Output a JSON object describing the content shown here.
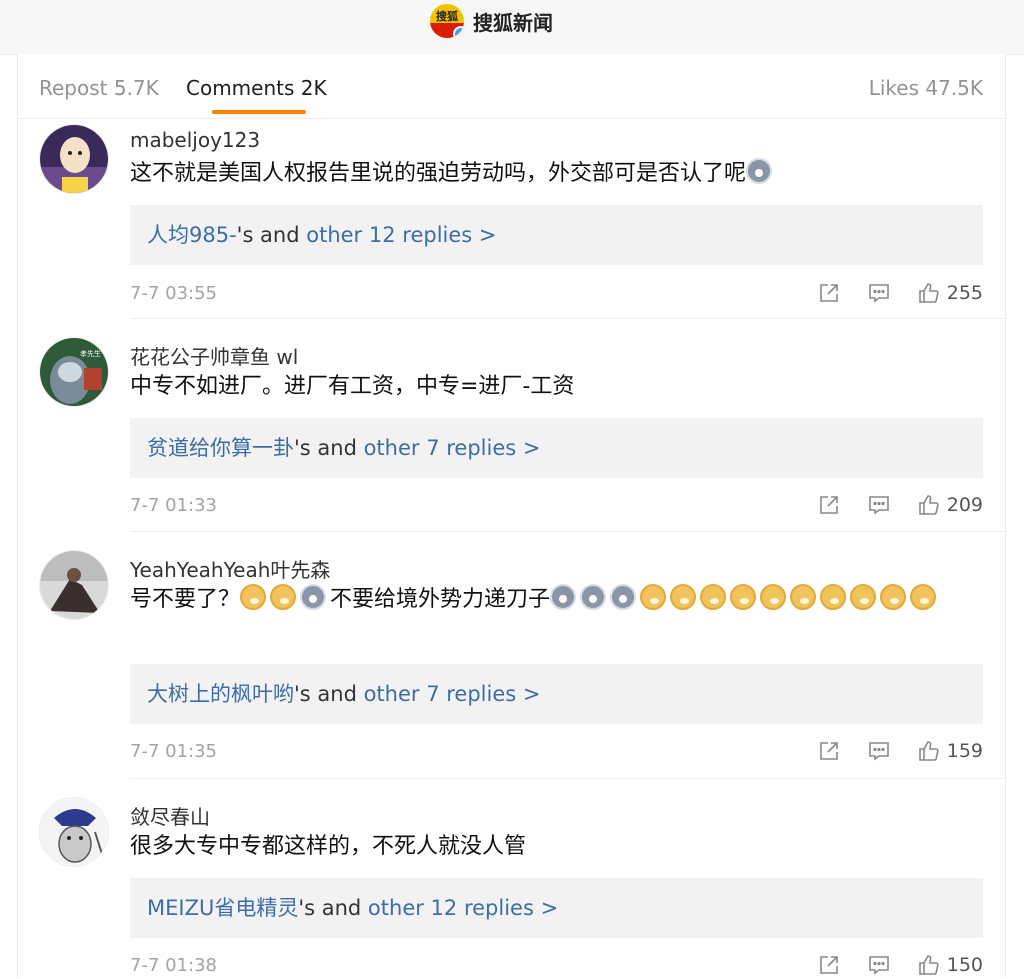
{
  "header": {
    "brand_logo_text": "搜狐",
    "brand_name": "搜狐新闻"
  },
  "tabs": {
    "repost": "Repost 5.7K",
    "comments": "Comments 2K",
    "likes": "Likes 47.5K"
  },
  "colors": {
    "accent": "#ff8200",
    "link": "#3e6da6",
    "muted": "#a3a3a3"
  },
  "comments": [
    {
      "user": "mabeljoy123",
      "text": "这不就是美国人权报告里说的强迫劳动吗，外交部可是否认了呢",
      "reply_user": "人均985-",
      "reply_mid": "'s and ",
      "reply_link": "other 12 replies >",
      "time": "7-7 03:55",
      "likes": "255"
    },
    {
      "user": "花花公子帅章鱼 wl",
      "text": "中专不如进厂。进厂有工资，中专=进厂-工资",
      "reply_user": "贫道给你算一卦",
      "reply_mid": "'s and ",
      "reply_link": "other 7 replies >",
      "time": "7-7 01:33",
      "likes": "209"
    },
    {
      "user": "YeahYeahYeah叶先森",
      "text_a": "号不要了？",
      "text_b": "不要给境外势力递刀子",
      "reply_user": "大树上的枫叶哟",
      "reply_mid": "'s and ",
      "reply_link": "other 7 replies >",
      "time": "7-7 01:35",
      "likes": "159"
    },
    {
      "user": "敛尽春山",
      "text": "很多大专中专都这样的，不死人就没人管",
      "reply_user": "MEIZU省电精灵",
      "reply_mid": "'s and ",
      "reply_link": "other 12 replies >",
      "time": "7-7 01:38",
      "likes": "150"
    }
  ],
  "icons": [
    "share-icon",
    "comment-icon",
    "thumbs-up-icon",
    "husky-emoji-icon",
    "doge-emoji-icon",
    "verified-badge-icon"
  ]
}
